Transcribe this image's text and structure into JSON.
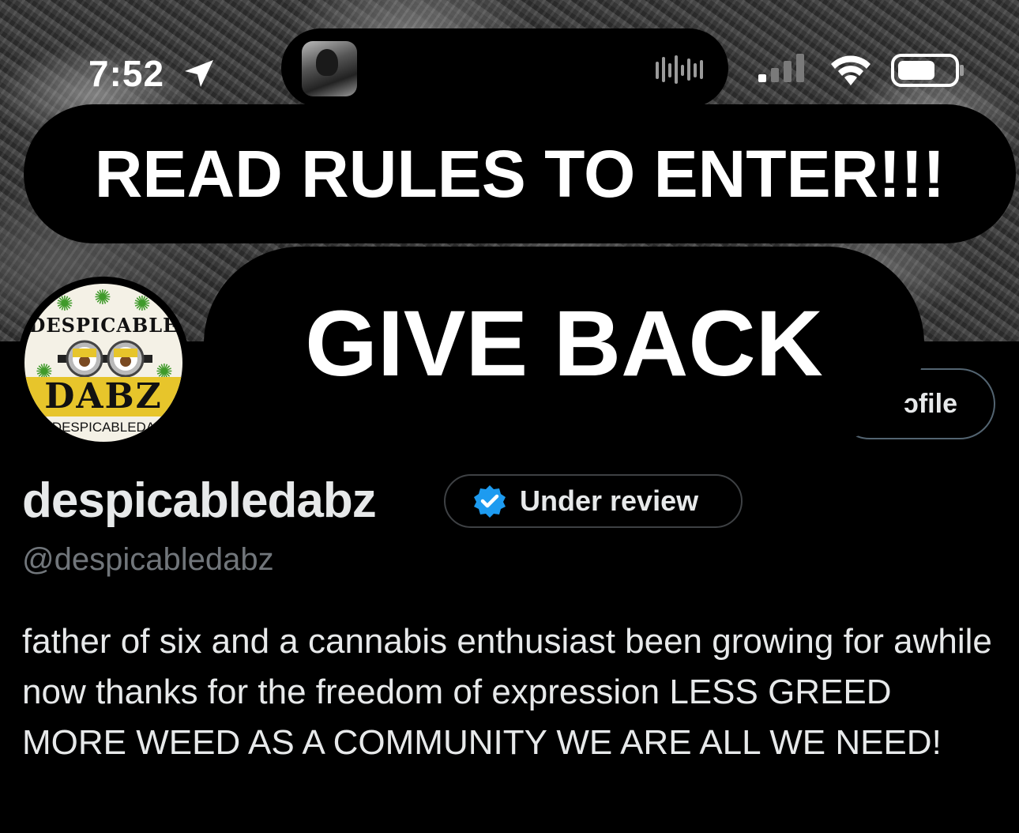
{
  "status_bar": {
    "time": "7:52",
    "icons": [
      "location-arrow-icon",
      "waveform-icon",
      "cellular-signal-icon",
      "wifi-icon",
      "battery-icon"
    ]
  },
  "overlay": {
    "rules_text": "READ RULES TO ENTER!!!",
    "give_back_text": "GIVE BACK"
  },
  "avatar": {
    "logo_top": "DESPICABLE",
    "logo_main": "DABZ",
    "logo_bottom": "DESPICABLEDA"
  },
  "edit_profile": {
    "label": "Edit profile",
    "visible_fragment": "ɔfile"
  },
  "profile": {
    "display_name": "despicabledabz",
    "verification_status": "Under review",
    "handle": "@despicabledabz",
    "bio": "father of six and a cannabis enthusiast been growing for awhile now thanks for the freedom of expression LESS GREED MORE WEED AS A COMMUNITY WE ARE ALL WE NEED!"
  },
  "colors": {
    "background": "#000000",
    "text_primary": "#e7e9ea",
    "text_secondary": "#71767b",
    "verified_blue": "#1d9bf0",
    "logo_yellow": "#e7c52b"
  }
}
